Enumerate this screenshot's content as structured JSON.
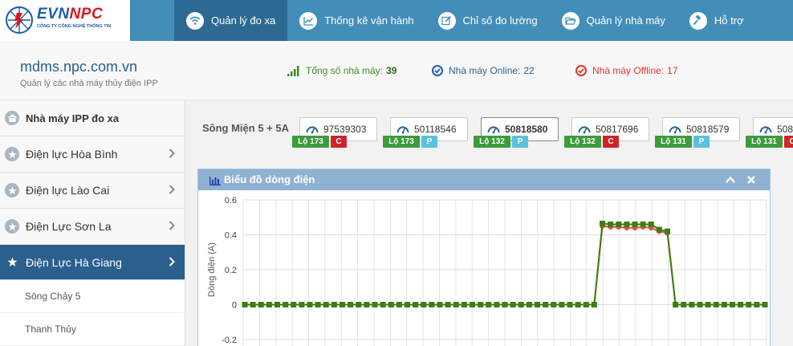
{
  "logo": {
    "brand_a": "EVN",
    "brand_b": "NPC",
    "subtitle": "CÔNG TY CÔNG NGHỆ THÔNG TIN"
  },
  "nav": [
    {
      "label": "Quản lý đo xa",
      "icon": "wifi-icon"
    },
    {
      "label": "Thống kê vận hành",
      "icon": "line-chart-icon"
    },
    {
      "label": "Chỉ số đo lường",
      "icon": "edit-icon"
    },
    {
      "label": "Quản lý nhà máy",
      "icon": "folder-open-icon"
    },
    {
      "label": "Hỗ trợ",
      "icon": "gavel-icon"
    }
  ],
  "header": {
    "site": "mdms.npc.com.vn",
    "subtitle": "Quản lý các nhà máy thủy điện IPP",
    "total_label": "Tổng số nhà máy:",
    "total_value": "39",
    "online_label": "Nhà máy Online:",
    "online_value": "22",
    "offline_label": "Nhà máy Offline:",
    "offline_value": "17"
  },
  "sidebar": {
    "head": "Nhà máy IPP đo xa",
    "items": [
      {
        "label": "Điện lực Hòa Bình"
      },
      {
        "label": "Điện lực Lào Cai"
      },
      {
        "label": "Điện Lực Sơn La"
      },
      {
        "label": "Điện Lực Hà Giang"
      }
    ],
    "subitems": [
      "Sông Chảy 5",
      "Thanh Thủy"
    ]
  },
  "plant": {
    "name": "Sông Miện 5 + 5A",
    "meters": [
      {
        "id": "97539303",
        "feeder": "Lộ 173",
        "status": "C"
      },
      {
        "id": "50118546",
        "feeder": "Lộ 173",
        "status": "P"
      },
      {
        "id": "50818580",
        "feeder": "Lộ 132",
        "status": "P"
      },
      {
        "id": "50817696",
        "feeder": "Lộ 132",
        "status": "C"
      },
      {
        "id": "50818579",
        "feeder": "Lộ 131",
        "status": "P"
      },
      {
        "id": "508",
        "feeder": "Lộ 131",
        "status": "C"
      }
    ]
  },
  "panel": {
    "title": "Biểu đồ dòng điện"
  },
  "colors": {
    "accent": "#438eb9",
    "online": "#2a6496",
    "offline": "#d9392c",
    "series_red": "#e0533a",
    "series_green": "#3e7d16"
  },
  "chart_data": {
    "type": "line",
    "ylabel": "Dòng điện (A)",
    "ylim": [
      -0.2,
      0.6
    ],
    "yticks": [
      "0.6",
      "0.4",
      "0.2",
      "0",
      "-0.2"
    ],
    "grid": true,
    "series": [
      {
        "color": "#e0533a",
        "values": [
          0,
          0,
          0,
          0,
          0,
          0,
          0,
          0,
          0,
          0,
          0,
          0,
          0,
          0,
          0,
          0,
          0,
          0,
          0,
          0,
          0,
          0,
          0,
          0,
          0,
          0,
          0,
          0,
          0,
          0,
          0,
          0,
          0,
          0,
          0,
          0,
          0,
          0,
          0,
          0,
          0,
          0,
          0,
          0,
          0.45,
          0.445,
          0.445,
          0.44,
          0.44,
          0.445,
          0.44,
          0.42,
          0.41,
          0,
          0,
          0,
          0,
          0,
          0,
          0,
          0,
          0,
          0,
          0,
          0
        ]
      },
      {
        "color": "#3e7d16",
        "values": [
          0,
          0,
          0,
          0,
          0,
          0,
          0,
          0,
          0,
          0,
          0,
          0,
          0,
          0,
          0,
          0,
          0,
          0,
          0,
          0,
          0,
          0,
          0,
          0,
          0,
          0,
          0,
          0,
          0,
          0,
          0,
          0,
          0,
          0,
          0,
          0,
          0,
          0,
          0,
          0,
          0,
          0,
          0,
          0,
          0.465,
          0.46,
          0.46,
          0.46,
          0.46,
          0.46,
          0.46,
          0.43,
          0.42,
          0,
          0,
          0,
          0,
          0,
          0,
          0,
          0,
          0,
          0,
          0,
          0
        ]
      }
    ]
  }
}
